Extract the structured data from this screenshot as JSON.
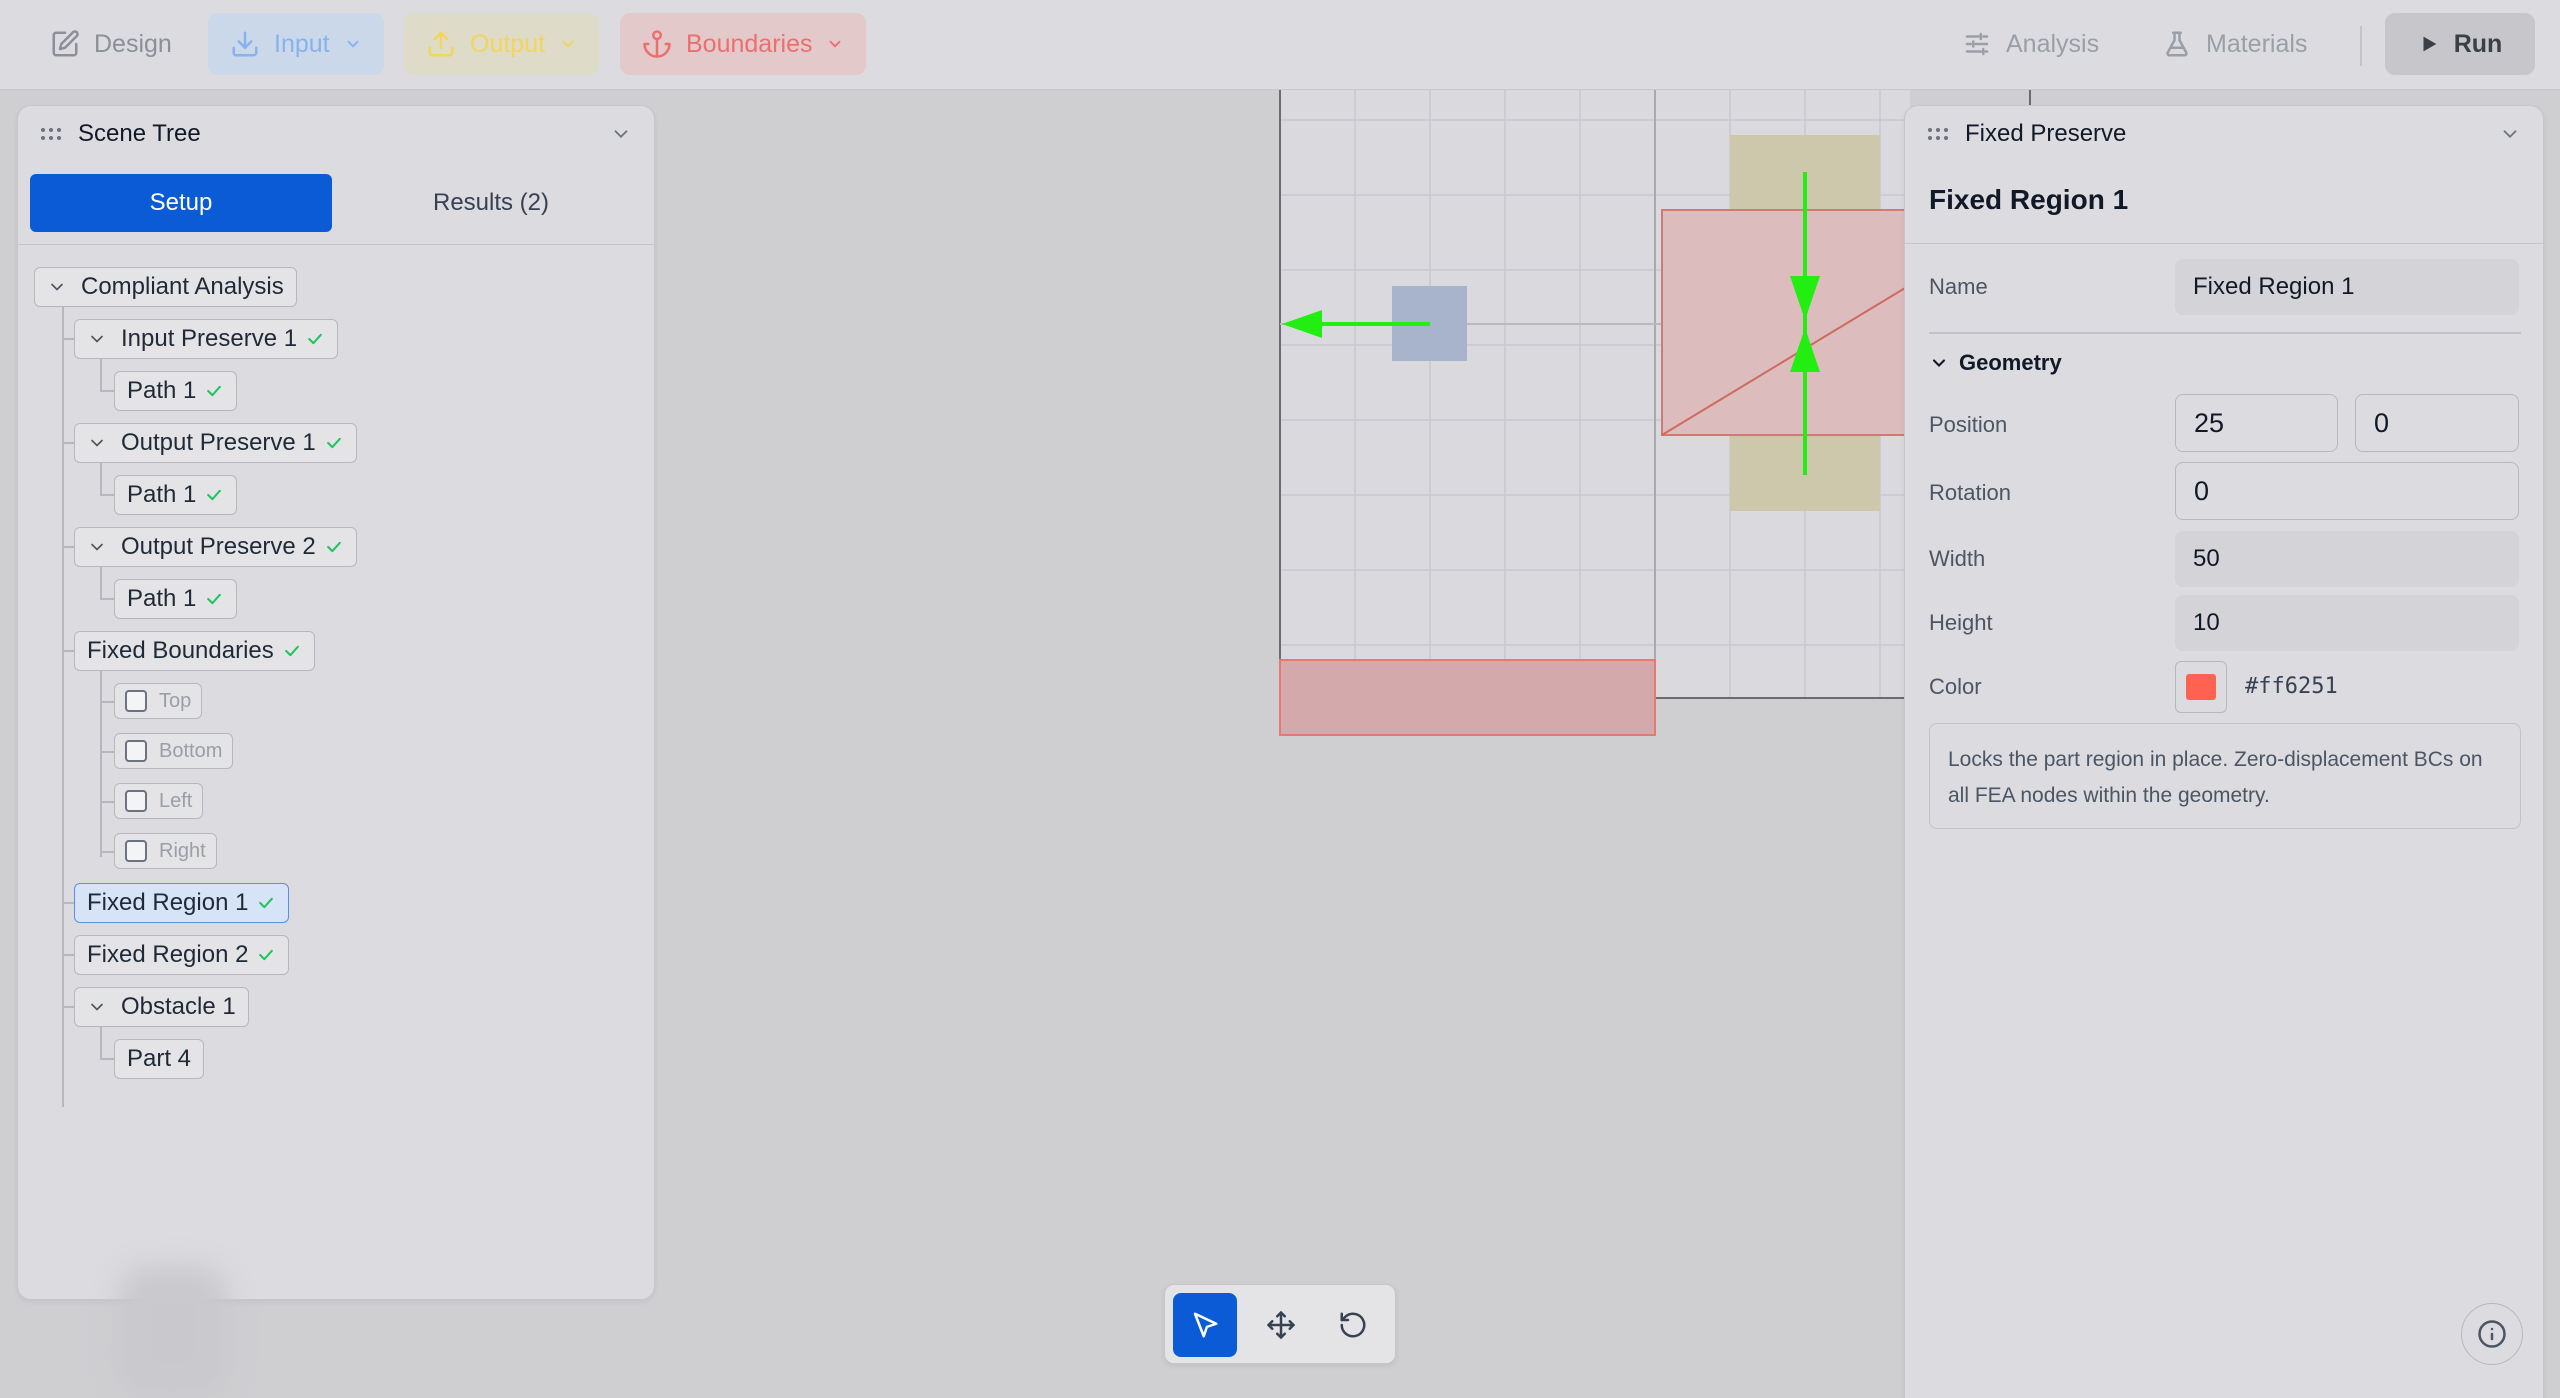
{
  "toolbar": {
    "design": "Design",
    "input": "Input",
    "output": "Output",
    "boundaries": "Boundaries",
    "analysis": "Analysis",
    "materials": "Materials",
    "run": "Run"
  },
  "scene_tree": {
    "title": "Scene Tree",
    "tabs": {
      "setup": "Setup",
      "results": "Results (2)"
    },
    "nodes": {
      "root": "Compliant Analysis",
      "input1": "Input Preserve 1",
      "input1_path": "Path 1",
      "output1": "Output Preserve 1",
      "output1_path": "Path 1",
      "output2": "Output Preserve 2",
      "output2_path": "Path 1",
      "fixed_boundaries": "Fixed Boundaries",
      "top": "Top",
      "bottom": "Bottom",
      "left": "Left",
      "right": "Right",
      "fixed_region1": "Fixed Region 1",
      "fixed_region2": "Fixed Region 2",
      "obstacle1": "Obstacle 1",
      "part4": "Part 4"
    }
  },
  "properties": {
    "panel_title": "Fixed Preserve",
    "subtitle": "Fixed Region 1",
    "name_label": "Name",
    "name_value": "Fixed Region 1",
    "geometry_label": "Geometry",
    "position_label": "Position",
    "position_x": "25",
    "position_y": "0",
    "rotation_label": "Rotation",
    "rotation_value": "0",
    "width_label": "Width",
    "width_value": "50",
    "height_label": "Height",
    "height_value": "10",
    "color_label": "Color",
    "color_value": "#ff6251",
    "description": "Locks the part region in place. Zero-displacement BCs on all FEA nodes within the geometry."
  },
  "colors": {
    "accent": "#0b5bd7",
    "fixed_region": "#ff6251",
    "arrow": "#22ee11",
    "check": "#22c55e"
  }
}
